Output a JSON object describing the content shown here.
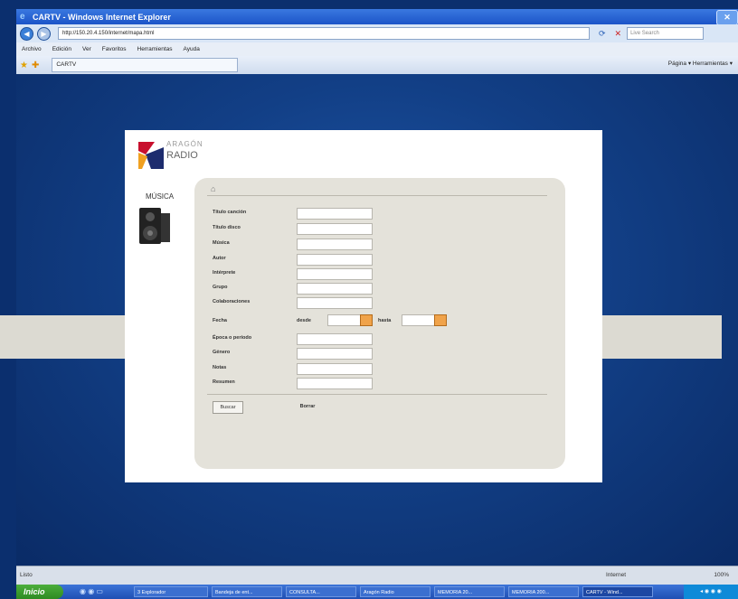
{
  "window": {
    "title": "CARTV - Windows Internet Explorer"
  },
  "address": {
    "url": "http://150.20.4.150/internet/mapa.html",
    "search_placeholder": "Live Search"
  },
  "menu": [
    "Archivo",
    "Edición",
    "Ver",
    "Favoritos",
    "Herramientas",
    "Ayuda"
  ],
  "tab": {
    "title": "CARTV"
  },
  "tools": {
    "label": "Página ▾ Herramientas ▾"
  },
  "site": {
    "logo_top": "ARAGÓN",
    "logo_bottom": "RADIO",
    "section": "MÚSICA"
  },
  "form": {
    "fields": [
      "Título canción",
      "Título disco",
      "Música",
      "Autor",
      "Intérprete",
      "Grupo",
      "Colaboraciones"
    ],
    "fecha": "Fecha",
    "desde": "desde",
    "hasta": "hasta",
    "fields2": [
      "Época o período",
      "Género",
      "Notas",
      "Resumen"
    ],
    "buttons": {
      "search": "Buscar",
      "clear": "Borrar"
    }
  },
  "status": {
    "left": "Listo",
    "zone": "Internet",
    "zoom": "100%"
  },
  "taskbar": {
    "start": "Inicio",
    "items": [
      "3 Explorador",
      "Bandeja de ent...",
      "CONSULTA...",
      "Aragón Radio",
      "MEMORIA 20...",
      "MEMORIA 200...",
      "CARTV - Wind..."
    ]
  },
  "colors": {
    "accent_red": "#c8102e",
    "accent_blue": "#1f4fb3",
    "panel": "#e4e2da"
  }
}
